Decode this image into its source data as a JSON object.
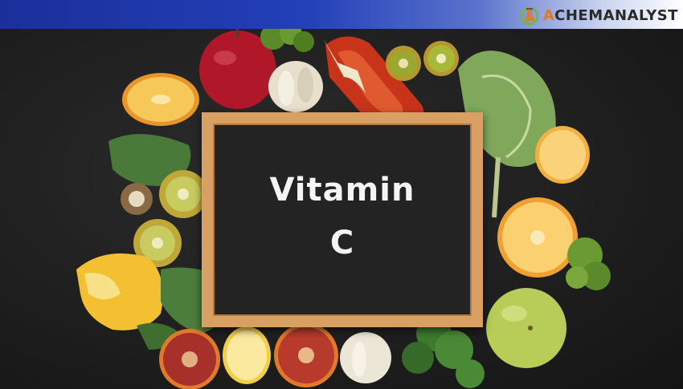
{
  "header": {
    "brand_prefix": "A",
    "brand_main": "CHEMANALYST",
    "brand_color": "#e07a1b"
  },
  "board": {
    "title_line1": "Vitamin",
    "title_line2": "C"
  },
  "colors": {
    "banner": "#1a2f9a",
    "frame": "#d8a062",
    "chalkboard": "#232323"
  }
}
